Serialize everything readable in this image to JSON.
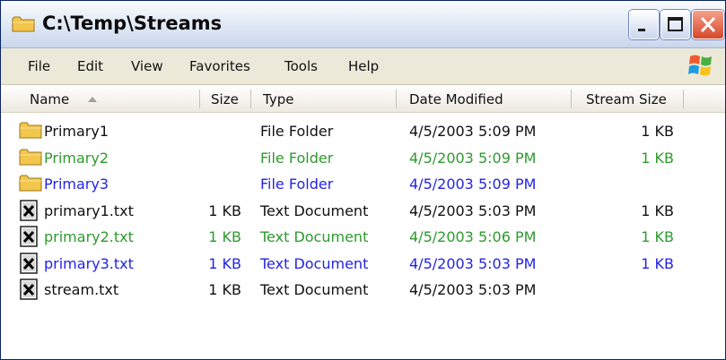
{
  "window": {
    "title": "C:\\Temp\\Streams"
  },
  "menu": [
    "File",
    "Edit",
    "View",
    "Favorites",
    "Tools",
    "Help"
  ],
  "columns": {
    "name": "Name",
    "size": "Size",
    "type": "Type",
    "date": "Date Modified",
    "stream": "Stream Size"
  },
  "colors": {
    "black": "#111111",
    "green": "#2e9a2e",
    "blue": "#2323e6"
  },
  "icons": {
    "folder": "folder-icon",
    "text_document": "text-document-icon",
    "windows_logo": "windows-logo-icon"
  },
  "files": [
    {
      "name": "Primary1",
      "size": "",
      "type": "File Folder",
      "date": "4/5/2003 5:09 PM",
      "stream": "1 KB",
      "color": "#111111",
      "icon": "folder"
    },
    {
      "name": "Primary2",
      "size": "",
      "type": "File Folder",
      "date": "4/5/2003 5:09 PM",
      "stream": "1 KB",
      "color": "#2e9a2e",
      "icon": "folder"
    },
    {
      "name": "Primary3",
      "size": "",
      "type": "File Folder",
      "date": "4/5/2003 5:09 PM",
      "stream": "",
      "color": "#2323e6",
      "icon": "folder"
    },
    {
      "name": "primary1.txt",
      "size": "1 KB",
      "type": "Text Document",
      "date": "4/5/2003 5:03 PM",
      "stream": "1 KB",
      "color": "#111111",
      "icon": "text"
    },
    {
      "name": "primary2.txt",
      "size": "1 KB",
      "type": "Text Document",
      "date": "4/5/2003 5:06 PM",
      "stream": "1 KB",
      "color": "#2e9a2e",
      "icon": "text"
    },
    {
      "name": "primary3.txt",
      "size": "1 KB",
      "type": "Text Document",
      "date": "4/5/2003 5:03 PM",
      "stream": "1 KB",
      "color": "#2323e6",
      "icon": "text"
    },
    {
      "name": "stream.txt",
      "size": "1 KB",
      "type": "Text Document",
      "date": "4/5/2003 5:03 PM",
      "stream": "",
      "color": "#111111",
      "icon": "text"
    }
  ]
}
